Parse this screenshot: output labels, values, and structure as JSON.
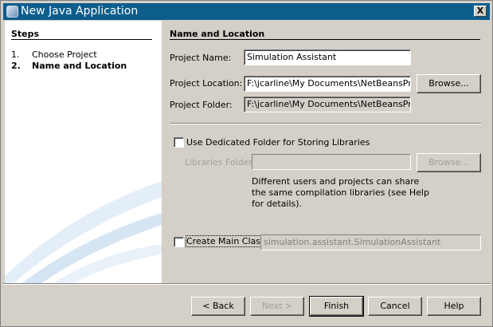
{
  "window": {
    "title": "New Java Application",
    "close_label": "X"
  },
  "steps": {
    "heading": "Steps",
    "items": [
      {
        "num": "1.",
        "label": "Choose Project"
      },
      {
        "num": "2.",
        "label": "Name and Location"
      }
    ]
  },
  "main": {
    "heading": "Name and Location",
    "project_name_label": "Project Name:",
    "project_name_value": "Simulation Assistant",
    "project_location_label": "Project Location:",
    "project_location_value": "F:\\jcarline\\My Documents\\NetBeansProject",
    "project_folder_label": "Project Folder:",
    "project_folder_value": "F:\\jcarline\\My Documents\\NetBeansProject",
    "browse_label": "Browse...",
    "dedicated_folder_label": "Use Dedicated Folder for Storing Libraries",
    "libraries_folder_label": "Libraries Folder:",
    "libraries_folder_value": "",
    "libraries_browse_label": "Browse...",
    "help_lines": [
      "Different users and projects can share",
      "the same compilation libraries (see Help",
      "for details)."
    ],
    "create_main_label": "Create Main Class",
    "main_class_value": "simulation.assistant.SimulationAssistant"
  },
  "buttons": {
    "back": "< Back",
    "next": "Next >",
    "finish": "Finish",
    "cancel": "Cancel",
    "help": "Help"
  }
}
